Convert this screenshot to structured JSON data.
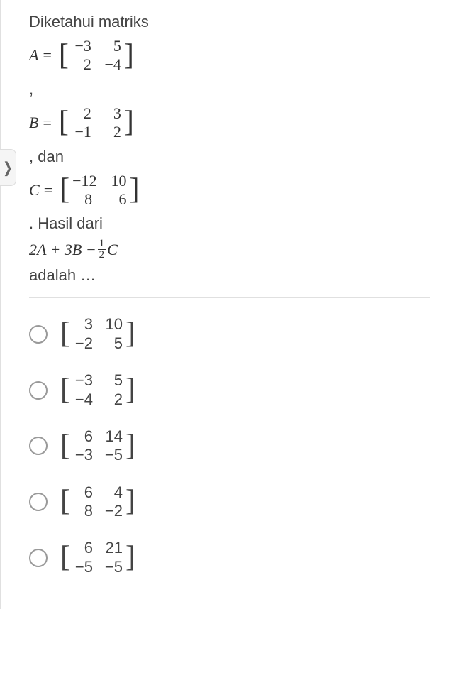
{
  "question": {
    "intro": "Diketahui matriks",
    "matrixA": {
      "label": "A",
      "eq": "=",
      "rows": [
        [
          "−3",
          "5"
        ],
        [
          "2",
          "−4"
        ]
      ]
    },
    "comma1": ",",
    "matrixB": {
      "label": "B",
      "eq": "=",
      "rows": [
        [
          "2",
          "3"
        ],
        [
          "−1",
          "2"
        ]
      ]
    },
    "dan": ", dan",
    "matrixC": {
      "label": "C",
      "eq": "=",
      "rows": [
        [
          "−12",
          "10"
        ],
        [
          "8",
          "6"
        ]
      ]
    },
    "hasil": ". Hasil dari",
    "expression": {
      "part1": "2A + 3B −",
      "frac_top": "1",
      "frac_bot": "2",
      "part2": "C"
    },
    "adalah": " adalah …"
  },
  "options": [
    {
      "rows": [
        [
          "3",
          "10"
        ],
        [
          "−2",
          "5"
        ]
      ]
    },
    {
      "rows": [
        [
          "−3",
          "5"
        ],
        [
          "−4",
          "2"
        ]
      ]
    },
    {
      "rows": [
        [
          "6",
          "14"
        ],
        [
          "−3",
          "−5"
        ]
      ]
    },
    {
      "rows": [
        [
          "6",
          "4"
        ],
        [
          "8",
          "−2"
        ]
      ]
    },
    {
      "rows": [
        [
          "6",
          "21"
        ],
        [
          "−5",
          "−5"
        ]
      ]
    }
  ],
  "nav_icon": "❭"
}
